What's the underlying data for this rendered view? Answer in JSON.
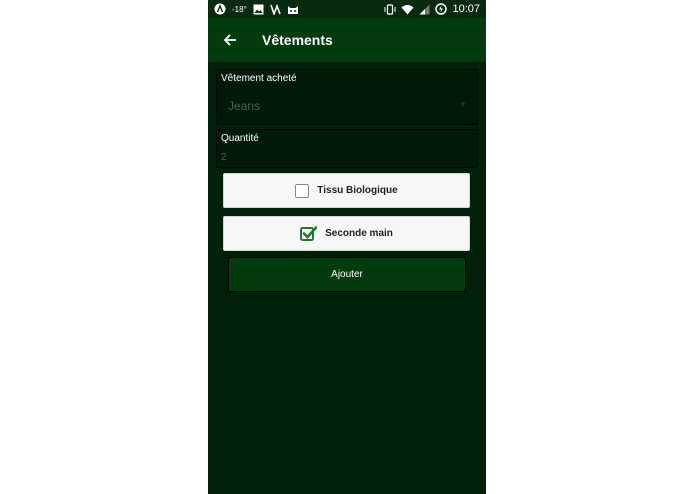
{
  "status_bar": {
    "temperature": "-18°",
    "time": "10:07",
    "icons": [
      "app-a-icon",
      "image-icon",
      "nfc-icon",
      "cat-icon",
      "vibrate-icon",
      "wifi-icon",
      "signal-icon",
      "data-saver-icon"
    ]
  },
  "app_bar": {
    "back_icon": "arrow-left-icon",
    "title": "Vêtements"
  },
  "form": {
    "clothing_field": {
      "label": "Vêtement acheté",
      "value": "Jeans"
    },
    "quantity_field": {
      "label": "Quantité",
      "value": "2"
    },
    "organic_checkbox": {
      "label": "Tissu Biologique",
      "checked": false
    },
    "second_hand_checkbox": {
      "label": "Seconde main",
      "checked": true
    },
    "submit_label": "Ajouter"
  },
  "colors": {
    "background": "#01200a",
    "app_bar": "#033a0e",
    "accent": "#1e7a2c"
  }
}
